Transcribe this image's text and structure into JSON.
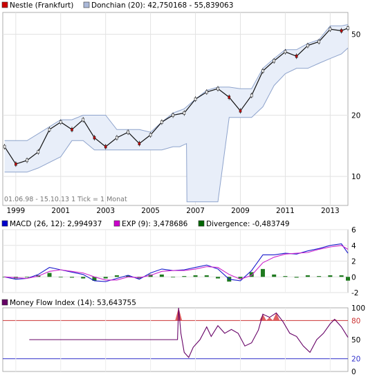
{
  "price_panel": {
    "legend": [
      {
        "label": "Nestle (Frankfurt)",
        "color": "#cc0000"
      },
      {
        "label": "Donchian (20): 42,750168 - 55,839063",
        "color": "#aab8d8"
      }
    ],
    "y_ticks": [
      {
        "label": "50",
        "value": 50
      },
      {
        "label": "20",
        "value": 20
      },
      {
        "label": "10",
        "value": 10
      }
    ],
    "x_ticks": [
      {
        "label": "1999",
        "year": 1999
      },
      {
        "label": "2001",
        "year": 2001
      },
      {
        "label": "2003",
        "year": 2003
      },
      {
        "label": "2005",
        "year": 2005
      },
      {
        "label": "2007",
        "year": 2007
      },
      {
        "label": "2009",
        "year": 2009
      },
      {
        "label": "2011",
        "year": 2011
      },
      {
        "label": "2013",
        "year": 2013
      }
    ],
    "footnote": "01.06.98 - 15.10.13   1 Tick = 1 Monat"
  },
  "macd_panel": {
    "legend": [
      {
        "label": "MACD (26, 12): 2,994937",
        "color": "#0000cc"
      },
      {
        "label": "EXP (9): 3,478686",
        "color": "#cc00cc"
      },
      {
        "label": "Divergence: -0,483749",
        "color": "#006600"
      }
    ],
    "y_ticks": [
      {
        "label": "6",
        "value": 6
      },
      {
        "label": "4",
        "value": 4
      },
      {
        "label": "2",
        "value": 2
      },
      {
        "label": "0",
        "value": 0
      },
      {
        "label": "-2",
        "value": -2
      }
    ]
  },
  "mfi_panel": {
    "legend": [
      {
        "label": "Money Flow Index (14): 53,643755",
        "color": "#660066"
      }
    ],
    "y_ticks": [
      {
        "label": "100",
        "value": 100
      },
      {
        "label": "80",
        "value": 80,
        "color": "#cc3333"
      },
      {
        "label": "50",
        "value": 50
      },
      {
        "label": "20",
        "value": 20,
        "color": "#3333cc"
      },
      {
        "label": "0",
        "value": 0
      }
    ]
  },
  "chart_data": [
    {
      "type": "line",
      "title": "Nestle (Frankfurt)",
      "scale": "log",
      "ylim": [
        7.2,
        64
      ],
      "xlim": [
        1998.42,
        2013.79
      ],
      "series": [
        {
          "name": "Nestle (Frankfurt)",
          "x": [
            1998.5,
            1999.0,
            1999.5,
            2000.0,
            2000.5,
            2001.0,
            2001.5,
            2002.0,
            2002.5,
            2003.0,
            2003.5,
            2004.0,
            2004.5,
            2005.0,
            2005.5,
            2006.0,
            2006.5,
            2007.0,
            2007.5,
            2008.0,
            2008.5,
            2009.0,
            2009.5,
            2010.0,
            2010.5,
            2011.0,
            2011.5,
            2012.0,
            2012.5,
            2013.0,
            2013.5,
            2013.79
          ],
          "y": [
            14,
            11.5,
            12,
            13.2,
            17,
            18.5,
            17,
            19,
            15.5,
            14,
            15.5,
            16.5,
            14.5,
            16,
            18.5,
            20,
            20.5,
            24,
            26,
            27,
            24.5,
            21,
            25,
            33,
            37,
            41,
            39,
            44,
            46,
            53,
            52,
            53.6
          ]
        },
        {
          "name": "Donchian (20) upper",
          "x": [
            1998.5,
            1999.5,
            2000.3,
            2001.0,
            2001.5,
            2002.0,
            2002.3,
            2003.0,
            2003.5,
            2004.0,
            2004.5,
            2005.0,
            2005.5,
            2006.0,
            2006.5,
            2007.0,
            2007.5,
            2008.0,
            2008.5,
            2009.0,
            2009.5,
            2010.0,
            2010.5,
            2011.0,
            2011.5,
            2012.0,
            2012.5,
            2013.0,
            2013.5,
            2013.79
          ],
          "y": [
            15,
            15,
            17,
            19,
            19,
            20,
            20,
            20,
            17,
            17,
            17,
            16.5,
            18.5,
            20.5,
            21.5,
            24,
            26.5,
            27.5,
            27.5,
            27,
            27,
            34,
            38,
            42,
            42,
            45,
            47,
            55,
            55,
            55.8
          ]
        },
        {
          "name": "Donchian (20) lower",
          "x": [
            1998.5,
            1999.5,
            2000.0,
            2001.0,
            2001.5,
            2002.0,
            2002.5,
            2003.0,
            2003.5,
            2004.0,
            2004.5,
            2005.0,
            2005.5,
            2006.0,
            2006.3,
            2006.6,
            2006.62,
            2007.5,
            2008.0,
            2008.5,
            2009.0,
            2009.5,
            2010.0,
            2010.5,
            2011.0,
            2011.5,
            2012.0,
            2012.5,
            2013.0,
            2013.5,
            2013.79
          ],
          "y": [
            10.5,
            10.5,
            11,
            12.5,
            15,
            15,
            13.5,
            13.5,
            13.5,
            13.5,
            13.5,
            13.5,
            13.5,
            14,
            14,
            14.5,
            7.5,
            7.5,
            7.5,
            19.5,
            19.5,
            19.5,
            22,
            28,
            32,
            34,
            34,
            36,
            38,
            40,
            42.8
          ]
        }
      ]
    },
    {
      "type": "line",
      "title": "MACD",
      "ylim": [
        -2,
        6
      ],
      "xlim": [
        1998.42,
        2013.79
      ],
      "series": [
        {
          "name": "MACD (26, 12)",
          "x": [
            1998.5,
            1999.0,
            1999.5,
            2000.0,
            2000.5,
            2001.0,
            2001.5,
            2002.0,
            2002.5,
            2003.0,
            2003.5,
            2004.0,
            2004.5,
            2005.0,
            2005.5,
            2006.0,
            2006.5,
            2007.0,
            2007.5,
            2008.0,
            2008.5,
            2009.0,
            2009.5,
            2010.0,
            2010.5,
            2011.0,
            2011.5,
            2012.0,
            2012.5,
            2013.0,
            2013.5,
            2013.79
          ],
          "y": [
            0,
            -0.3,
            -0.2,
            0.3,
            1.2,
            0.9,
            0.6,
            0.3,
            -0.5,
            -0.6,
            -0.2,
            0.2,
            -0.3,
            0.5,
            1.0,
            0.8,
            0.9,
            1.2,
            1.5,
            1.0,
            -0.3,
            -0.5,
            0.8,
            2.8,
            2.8,
            3.0,
            2.9,
            3.3,
            3.6,
            4.0,
            4.2,
            3.0
          ]
        },
        {
          "name": "EXP (9)",
          "x": [
            1998.5,
            1999.0,
            1999.5,
            2000.0,
            2000.5,
            2001.0,
            2001.5,
            2002.0,
            2002.5,
            2003.0,
            2003.5,
            2004.0,
            2004.5,
            2005.0,
            2005.5,
            2006.0,
            2006.5,
            2007.0,
            2007.5,
            2008.0,
            2008.5,
            2009.0,
            2009.5,
            2010.0,
            2010.5,
            2011.0,
            2011.5,
            2012.0,
            2012.5,
            2013.0,
            2013.5,
            2013.79
          ],
          "y": [
            0,
            -0.1,
            -0.2,
            0.1,
            0.7,
            0.9,
            0.7,
            0.5,
            0.0,
            -0.4,
            -0.4,
            0.0,
            -0.1,
            0.2,
            0.7,
            0.8,
            0.8,
            1.0,
            1.3,
            1.2,
            0.3,
            -0.3,
            0.2,
            1.8,
            2.5,
            2.9,
            3.0,
            3.1,
            3.5,
            3.8,
            4.0,
            3.5
          ]
        }
      ],
      "histogram": {
        "name": "Divergence",
        "x": [
          1998.5,
          1999.0,
          1999.5,
          2000.0,
          2000.5,
          2001.0,
          2001.5,
          2002.0,
          2002.5,
          2003.0,
          2003.5,
          2004.0,
          2004.5,
          2005.0,
          2005.5,
          2006.0,
          2006.5,
          2007.0,
          2007.5,
          2008.0,
          2008.5,
          2009.0,
          2009.5,
          2010.0,
          2010.5,
          2011.0,
          2011.5,
          2012.0,
          2012.5,
          2013.0,
          2013.5,
          2013.79
        ],
        "y": [
          0,
          -0.2,
          0,
          0.2,
          0.5,
          0,
          -0.1,
          -0.2,
          -0.5,
          -0.2,
          0.2,
          0.2,
          -0.2,
          0.3,
          0.3,
          0,
          0.1,
          0.2,
          0.2,
          -0.2,
          -0.6,
          -0.2,
          0.6,
          1.0,
          0.3,
          0.1,
          -0.1,
          0.2,
          0.1,
          0.2,
          0.2,
          -0.48
        ]
      }
    },
    {
      "type": "line",
      "title": "Money Flow Index (14)",
      "ylim": [
        0,
        100
      ],
      "xlim": [
        1998.42,
        2013.79
      ],
      "reference_lines": [
        80,
        20
      ],
      "series": [
        {
          "name": "Money Flow Index (14)",
          "x": [
            1999.6,
            2006.2,
            2006.25,
            2006.35,
            2006.5,
            2006.7,
            2006.9,
            2007.2,
            2007.5,
            2007.7,
            2008.0,
            2008.3,
            2008.6,
            2008.9,
            2009.2,
            2009.5,
            2009.8,
            2010.0,
            2010.3,
            2010.6,
            2010.9,
            2011.2,
            2011.5,
            2011.8,
            2012.1,
            2012.4,
            2012.7,
            2013.0,
            2013.2,
            2013.5,
            2013.79
          ],
          "y": [
            50,
            50,
            100,
            60,
            30,
            22,
            38,
            50,
            70,
            55,
            72,
            60,
            66,
            60,
            40,
            45,
            65,
            90,
            85,
            92,
            78,
            60,
            55,
            40,
            30,
            50,
            60,
            75,
            82,
            70,
            53.6
          ]
        }
      ]
    }
  ]
}
